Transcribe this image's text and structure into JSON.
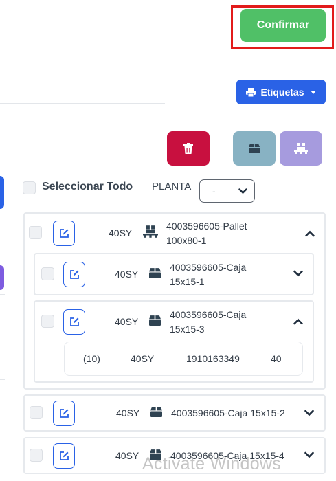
{
  "header": {
    "confirm_label": "Confirmar",
    "etiquetas_label": "Etiquetas"
  },
  "actions": {
    "delete_icon": "trash-icon",
    "box_icon": "box-icon",
    "pallet_icon": "pallet-icon"
  },
  "filters": {
    "select_all_label": "Seleccionar Todo",
    "planta_label": "PLANTA",
    "planta_value": "-"
  },
  "items": [
    {
      "code": "40SY",
      "type": "pallet",
      "description_line1": "4003596605-Pallet",
      "description_line2": "100x80-1",
      "expanded": true
    },
    {
      "code": "40SY",
      "type": "box",
      "description_line1": "4003596605-Caja",
      "description_line2": "15x15-1",
      "expanded": false
    },
    {
      "code": "40SY",
      "type": "box",
      "description_line1": "4003596605-Caja",
      "description_line2": "15x15-3",
      "expanded": true,
      "detail": {
        "quantity": "(10)",
        "code": "40SY",
        "number": "1910163349",
        "value": "40"
      }
    },
    {
      "code": "40SY",
      "type": "box",
      "description": "4003596605-Caja 15x15-2",
      "expanded": false
    },
    {
      "code": "40SY",
      "type": "box",
      "description": "4003596605-Caja 15x15-4",
      "expanded": false
    }
  ],
  "colors": {
    "confirm": "#50c067",
    "primary": "#2a62e6",
    "delete": "#c8103f",
    "box": "#88b2c3",
    "pallet": "#a69bde",
    "highlight": "#e21b1b"
  },
  "watermark": "Activate Windows"
}
